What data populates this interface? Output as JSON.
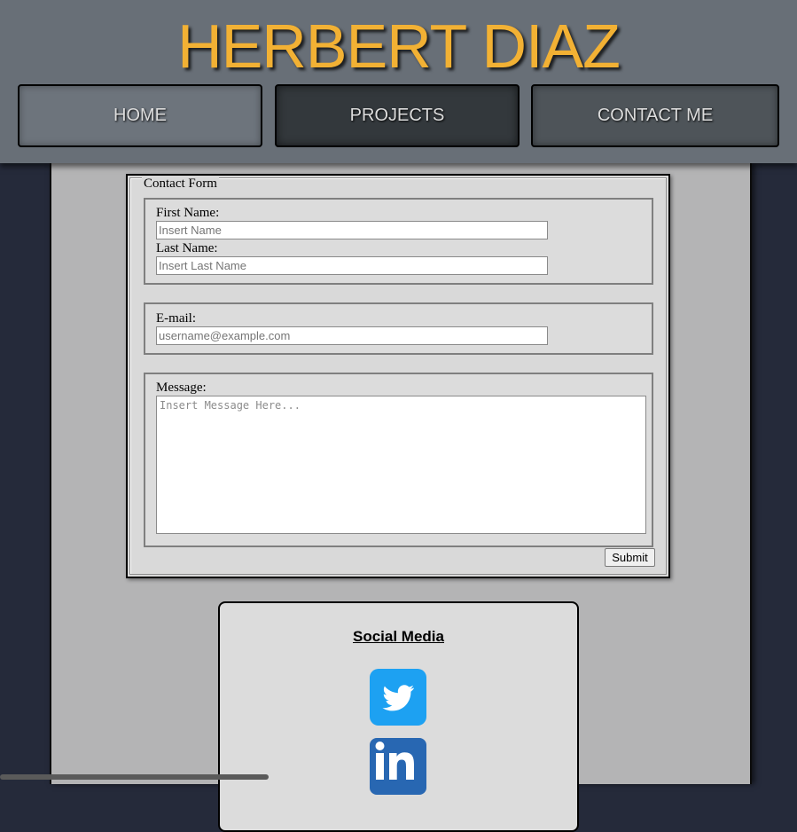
{
  "header": {
    "title": "HERBERT DIAZ"
  },
  "nav": {
    "items": [
      {
        "label": "HOME"
      },
      {
        "label": "PROJECTS"
      },
      {
        "label": "CONTACT ME"
      }
    ]
  },
  "contact_form": {
    "legend": "Contact Form",
    "first_name": {
      "label": "First Name:",
      "placeholder": "Insert Name"
    },
    "last_name": {
      "label": "Last Name:",
      "placeholder": "Insert Last Name"
    },
    "email": {
      "label": "E-mail:",
      "placeholder": "username@example.com"
    },
    "message": {
      "label": "Message:",
      "placeholder": "Insert Message Here..."
    },
    "submit_label": "Submit"
  },
  "social": {
    "title": "Social Media",
    "icons": [
      "twitter-icon",
      "linkedin-icon"
    ]
  },
  "colors": {
    "title": "#f2b134",
    "header_bg": "#686f77",
    "page_bg": "#252a3a",
    "content_bg": "#b4b4b5",
    "twitter": "#1da1f2",
    "linkedin": "#2867b2"
  }
}
